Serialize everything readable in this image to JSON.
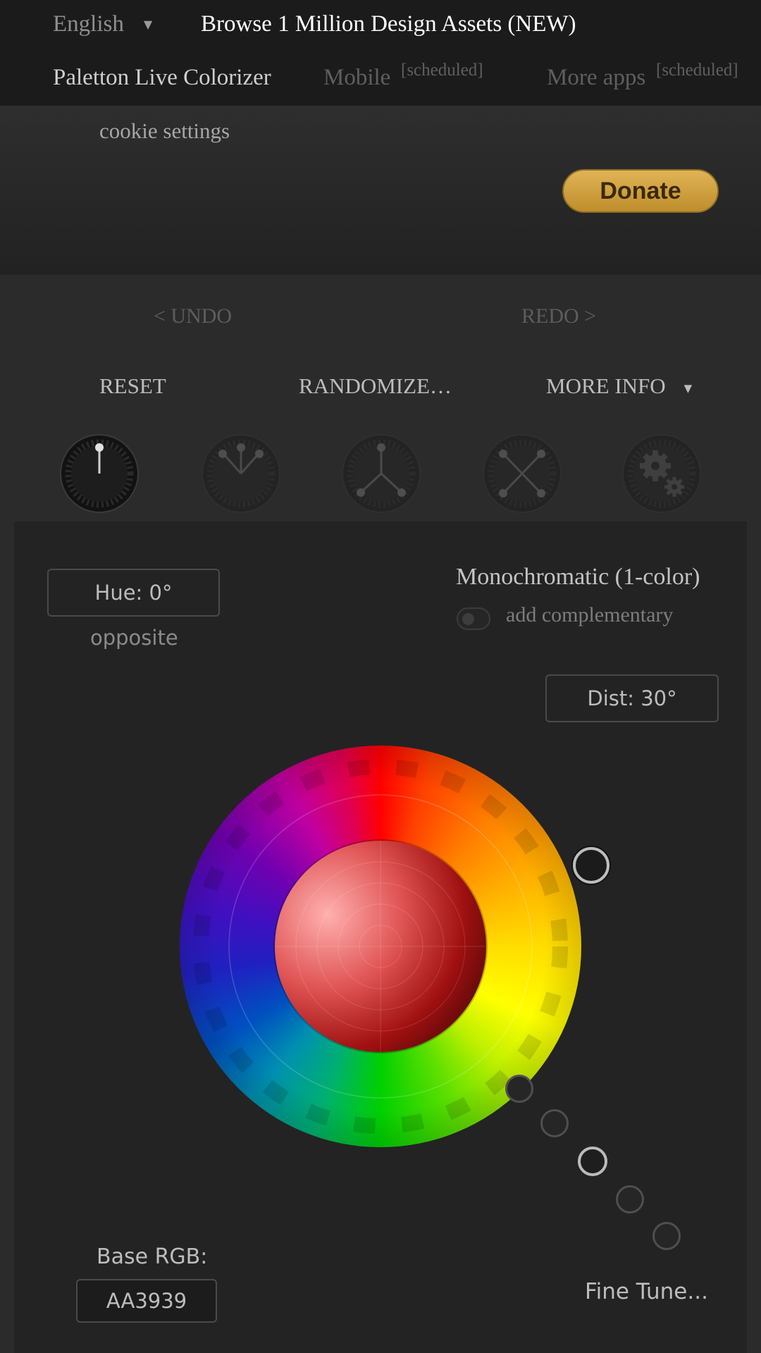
{
  "topbar": {
    "language": "English",
    "browse_link": "Browse 1 Million Design Assets (NEW)",
    "app_title": "Paletton Live Colorizer",
    "mobile": "Mobile",
    "mobile_badge": "[scheduled]",
    "more_apps": "More apps",
    "more_apps_badge": "[scheduled]"
  },
  "cookie_settings": "cookie settings",
  "donate_label": "Donate",
  "history": {
    "undo": "< UNDO",
    "redo": "REDO >"
  },
  "controls": {
    "reset": "RESET",
    "randomize": "RANDOMIZE…",
    "more_info": "MORE INFO"
  },
  "scheme_dials": [
    {
      "icon": "mono-dial-icon",
      "active": true
    },
    {
      "icon": "adjacent-dial-icon",
      "active": false
    },
    {
      "icon": "triad-dial-icon",
      "active": false
    },
    {
      "icon": "tetrad-dial-icon",
      "active": false
    },
    {
      "icon": "settings-dial-icon",
      "active": false
    }
  ],
  "hue": {
    "label": "Hue: 0°",
    "sub": "opposite"
  },
  "scheme": {
    "title": "Monochromatic (1-color)",
    "complementary_label": "add complementary"
  },
  "dist": {
    "label": "Dist: 30°"
  },
  "base": {
    "label": "Base RGB:",
    "value": "AA3939"
  },
  "fine_tune": "Fine Tune...",
  "colors": {
    "accent": "#AA3939",
    "donate": "#D8A845"
  }
}
